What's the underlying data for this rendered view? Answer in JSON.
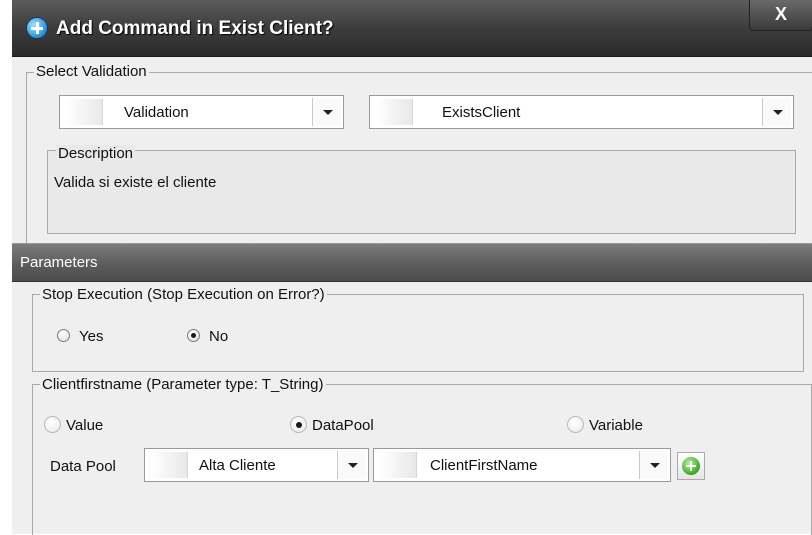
{
  "window": {
    "title": "Add Command in Exist Client?",
    "close_label": "X"
  },
  "select_validation": {
    "legend": "Select Validation",
    "type_combo": {
      "value": "Validation"
    },
    "validation_combo": {
      "value": "ExistsClient"
    },
    "description": {
      "legend": "Description",
      "text": "Valida si existe el cliente"
    }
  },
  "parameters": {
    "header": "Parameters",
    "stop_execution": {
      "legend": "Stop Execution (Stop Execution on Error?)",
      "options": [
        {
          "label": "Yes",
          "checked": false
        },
        {
          "label": "No",
          "checked": true
        }
      ]
    },
    "clientfirstname": {
      "legend": "Clientfirstname (Parameter type: T_String)",
      "options": [
        {
          "label": "Value",
          "checked": false
        },
        {
          "label": "DataPool",
          "checked": true
        },
        {
          "label": "Variable",
          "checked": false
        }
      ],
      "data_pool_label": "Data Pool",
      "pool_combo": {
        "value": "Alta Cliente"
      },
      "field_combo": {
        "value": "ClientFirstName"
      }
    }
  },
  "icons": {
    "title_icon": "info-plus-icon",
    "add_icon": "add-icon"
  }
}
